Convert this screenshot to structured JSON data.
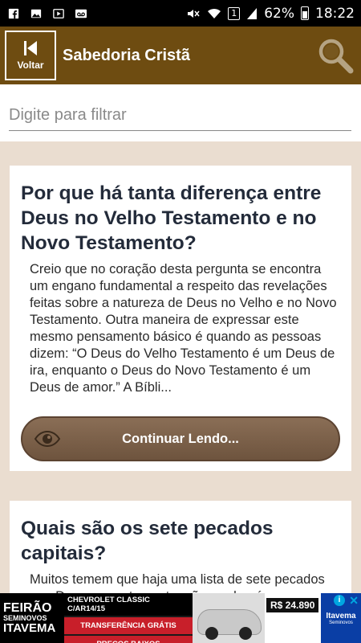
{
  "status_bar": {
    "battery_percent": "62%",
    "time": "18:22",
    "sim_slot": "1",
    "left_icons": [
      "facebook-icon",
      "image-icon",
      "play-store-icon",
      "voicemail-icon"
    ],
    "right_icons": [
      "mute-icon",
      "wifi-icon",
      "sim-icon",
      "signal-icon",
      "battery-charging-icon"
    ]
  },
  "app_bar": {
    "back_label": "Voltar",
    "title": "Sabedoria Cristã",
    "background_color": "#6e4c11"
  },
  "filter": {
    "placeholder": "Digite para filtrar",
    "value": ""
  },
  "cards": [
    {
      "title": "Por que há tanta diferença entre Deus no Velho Testamento e no Novo Testamento?",
      "excerpt": "Creio que no coração desta pergunta se encontra um engano fundamental a respeito das revelações feitas sobre a natureza de Deus no Velho e no Novo Testamento. Outra maneira de expressar este mesmo pensamento básico é quando as pessoas dizem: “O Deus do Velho Testamento é um Deus de ira, enquanto o Deus do Novo Testamento é um Deus de amor.” A Bíbli...",
      "button_label": "Continuar Lendo..."
    },
    {
      "title": "Quais são os sete pecados capitais?",
      "excerpt": "Muitos temem que haja uma lista de sete pecados que Deus, supostamente, não perdoará"
    }
  ],
  "ad": {
    "brand_line1": "FEIRÃO",
    "brand_line2": "SEMINOVOS",
    "brand_line3": "ITAVEMA",
    "car_model": "CHEVROLET CLASSIC C/AR14/15",
    "offer1": "TRANSFERÊNCIA GRÁTIS",
    "offer2": "PREÇOS BAIXOS",
    "price": "R$ 24.890",
    "dealer": "Itavema",
    "dealer_sub": "Seminovos",
    "info_label": "i",
    "close_label": "✕"
  }
}
